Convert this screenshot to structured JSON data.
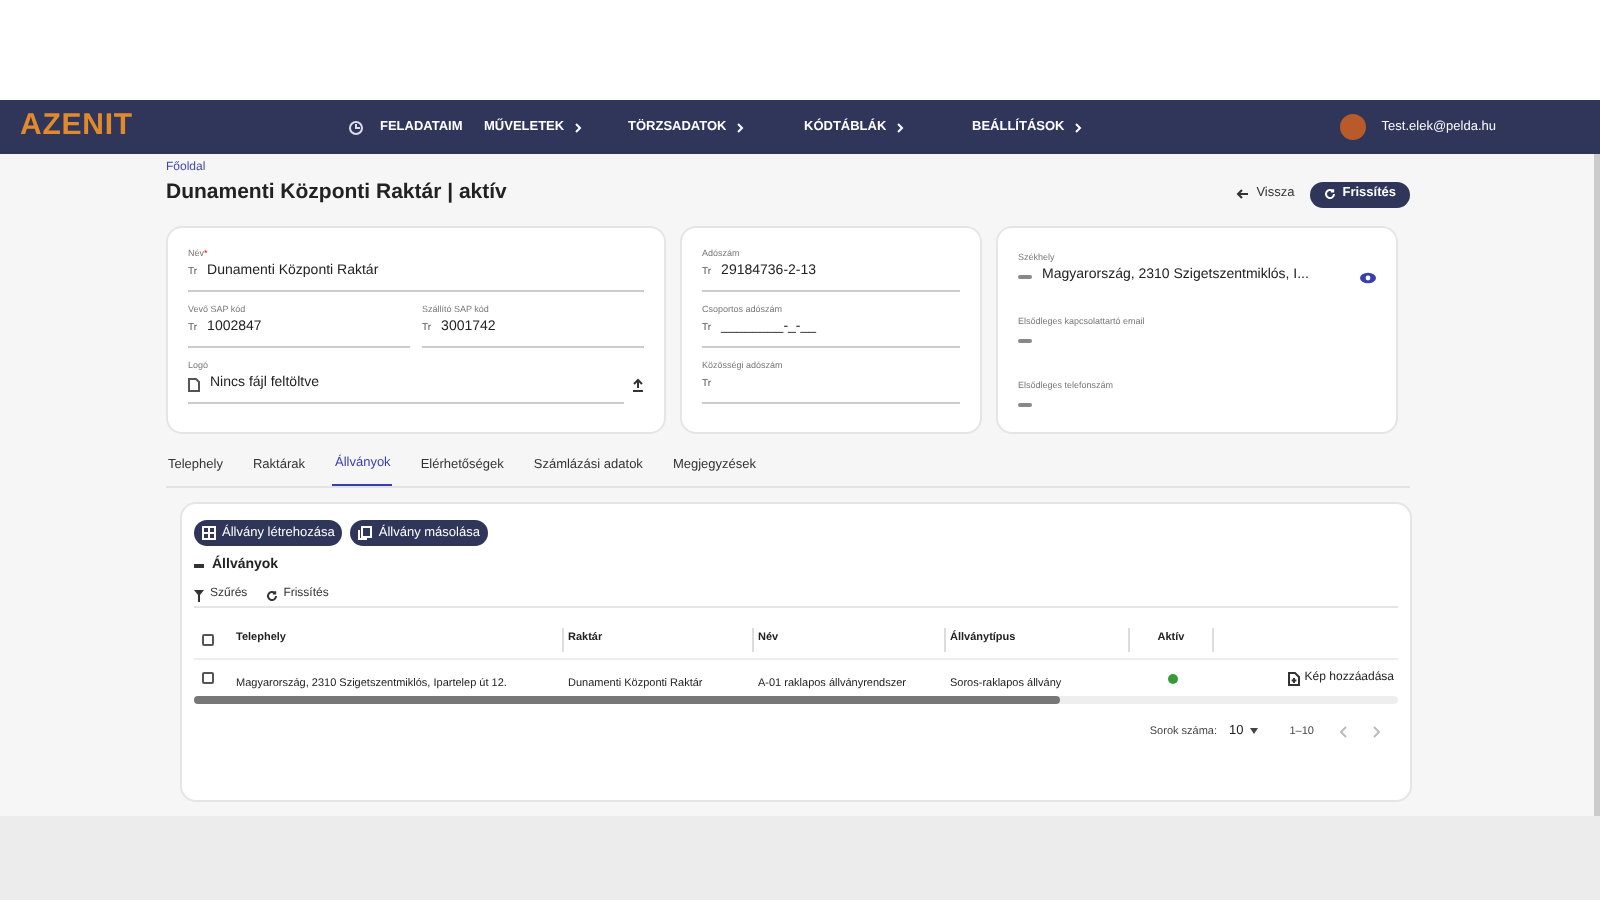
{
  "navbar": {
    "logo": "AZENIT",
    "menu": [
      {
        "label": "FELADATAIM",
        "has_submenu": false
      },
      {
        "label": "MŰVELETEK",
        "has_submenu": true
      },
      {
        "label": "TÖRZSADATOK",
        "has_submenu": true
      },
      {
        "label": "KÓDTÁBLÁK",
        "has_submenu": true
      },
      {
        "label": "BEÁLLÍTÁSOK",
        "has_submenu": true
      }
    ],
    "user": "Test.elek@pelda.hu"
  },
  "breadcrumb": "Főoldal",
  "title": "Dunamenti Központi Raktár | aktív",
  "actions": {
    "back": "Vissza",
    "refresh": "Frissítés"
  },
  "card_1": {
    "name": {
      "label": "Név",
      "required_mark": "*",
      "prefix": "Tr",
      "value": "Dunamenti Központi Raktár"
    },
    "buyer_sap": {
      "label": "Vevő SAP kód",
      "prefix": "Tr",
      "value": "1002847"
    },
    "supplier_sap": {
      "label": "Szállító SAP kód",
      "prefix": "Tr",
      "value": "3001742"
    },
    "logo": {
      "label": "Logó",
      "value": "Nincs fájl feltöltve"
    }
  },
  "card_2": [
    {
      "label": "Adószám",
      "prefix": "Tr",
      "value": "29184736-2-13"
    },
    {
      "label": "Csoportos adószám",
      "prefix": "Tr",
      "value": "________-_-__"
    },
    {
      "label": "Közösségi adószám",
      "prefix": "Tr"
    }
  ],
  "card_3": [
    {
      "label": "Székhely",
      "value": "Magyarország, 2310 Szigetszentmiklós, I...",
      "reveal": true
    },
    {
      "label": "Elsődleges kapcsolattartó email",
      "reveal": false
    },
    {
      "label": "Elsődleges telefonszám",
      "reveal": false
    }
  ],
  "tabs": [
    {
      "label": "Telephely",
      "selected": false
    },
    {
      "label": "Raktárak",
      "selected": false
    },
    {
      "label": "Állványok",
      "selected": true
    },
    {
      "label": "Elérhetőségek",
      "selected": false
    },
    {
      "label": "Számlázási adatok",
      "selected": false
    },
    {
      "label": "Megjegyzések",
      "selected": false
    }
  ],
  "panel": {
    "buttons": [
      {
        "kind": "grid",
        "label": "Állvány létrehozása"
      },
      {
        "kind": "copy",
        "label": "Állvány másolása"
      }
    ],
    "section_title": "Állványok",
    "toolbar": [
      {
        "kind": "filter",
        "label": "Szűrés"
      },
      {
        "kind": "refresh",
        "label": "Frissítés"
      }
    ],
    "table": {
      "select_all_checked": false,
      "columns": [
        "Telephely",
        "Raktár",
        "Név",
        "Állványtípus",
        "Aktív"
      ],
      "rows": [
        {
          "checked": false,
          "cells": [
            "Magyarország, 2310 Szigetszentmiklós, Ipartelep út 12.",
            "Dunamenti Központi Raktár",
            "A-01 raklapos állványrendszer",
            "Soros-raklapos állvány"
          ],
          "active": true,
          "action": "Kép hozzáadása"
        }
      ]
    },
    "pagination": {
      "rows_label": "Sorok száma:",
      "rows_value": "10",
      "range": "1–10"
    }
  }
}
